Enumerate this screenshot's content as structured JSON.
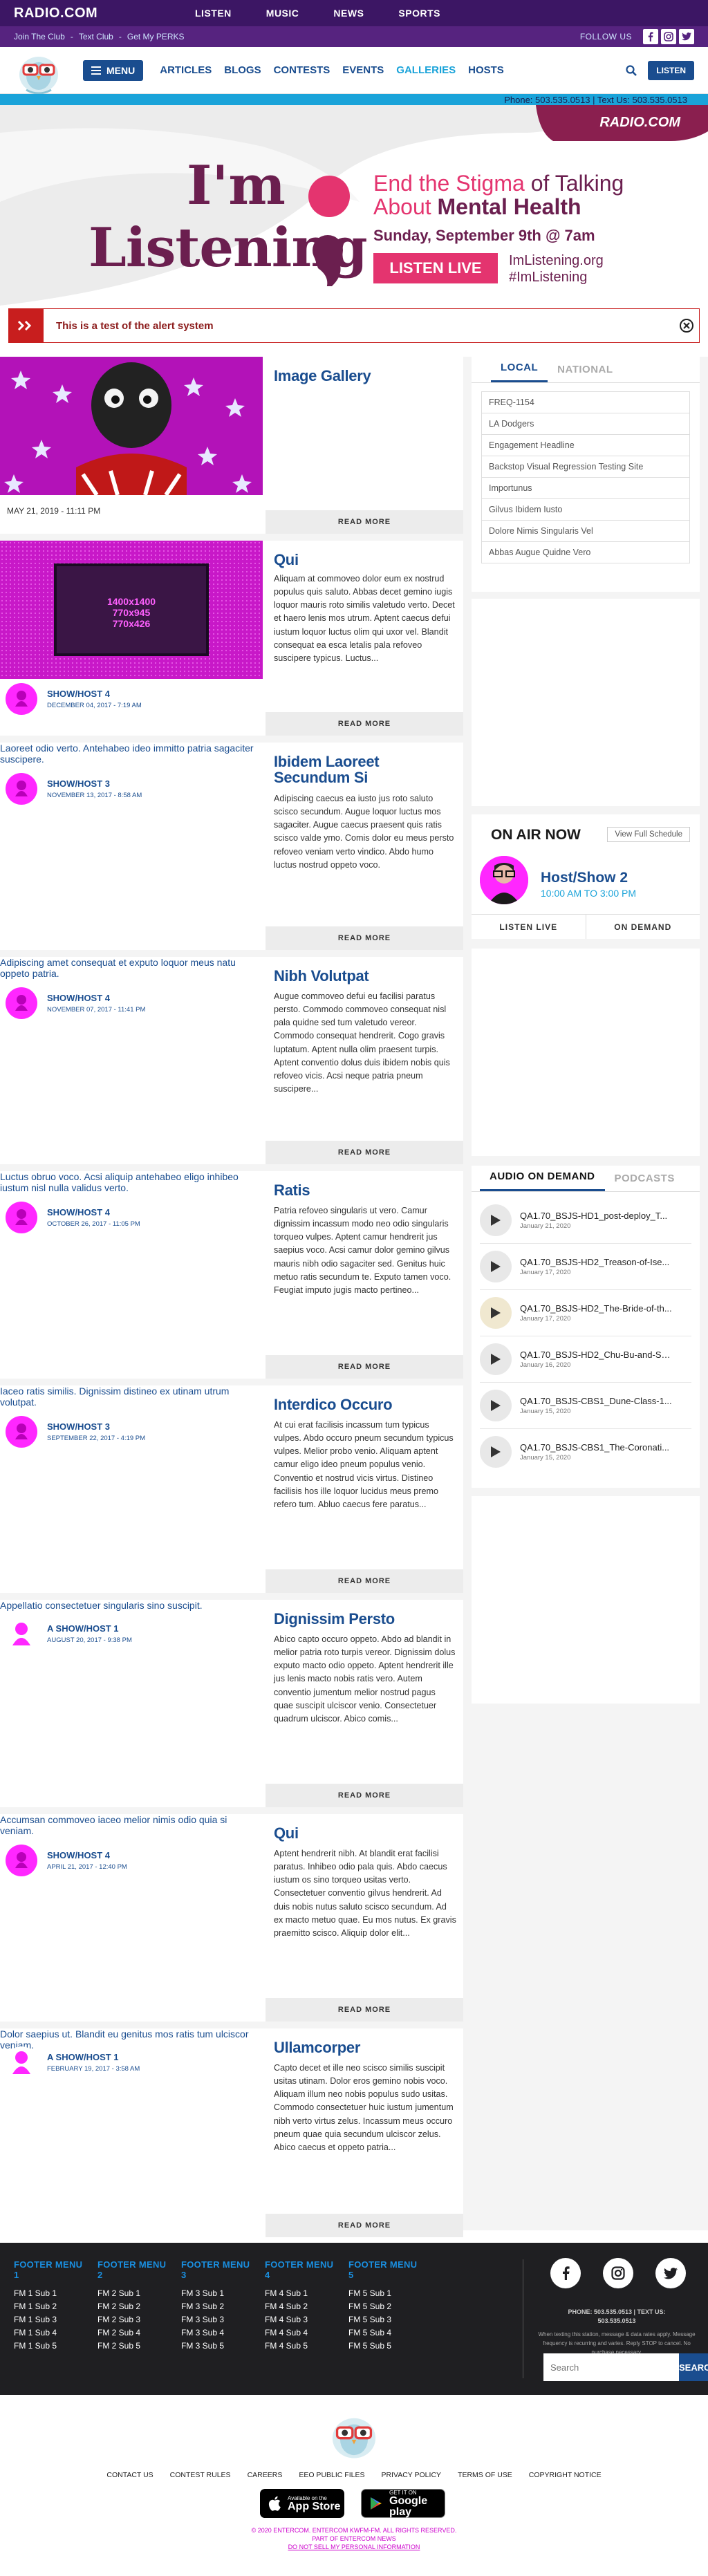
{
  "top": {
    "logo": "RADIO.COM",
    "nav": [
      "LISTEN",
      "MUSIC",
      "NEWS",
      "SPORTS"
    ]
  },
  "subbar": {
    "links": [
      "Join The Club",
      "Text Club",
      "Get My PERKS"
    ],
    "follow": "FOLLOW US"
  },
  "header": {
    "menu": "MENU",
    "nav": [
      "ARTICLES",
      "BLOGS",
      "CONTESTS",
      "EVENTS",
      "GALLERIES",
      "HOSTS"
    ],
    "active": "GALLERIES",
    "listen": "LISTEN"
  },
  "phonebar": "Phone: 503.535.0513 | Text Us: 503.535.0513",
  "hero": {
    "brand": "RADIO.COM",
    "line1": "I'm",
    "line2": "Listening",
    "h1a": "End the Stigma",
    "h1b": " of Talking",
    "h2a": "About ",
    "h2b": "Mental Health",
    "date": "Sunday, September 9th @ 7am",
    "cta": "LISTEN LIVE",
    "site": "ImListening.org",
    "tag": "#ImListening",
    "colors": {
      "plum": "#6b1f4f",
      "pink": "#e4346f"
    }
  },
  "alert": "This is a test of the alert system",
  "cards": [
    {
      "title": "Image Gallery",
      "date": "MAY 21, 2019 - 11:11 PM",
      "more": "READ MORE"
    },
    {
      "title": "Qui",
      "img_text": [
        "1400x1400",
        "770x945",
        "770x426"
      ],
      "excerpt": "Aliquam at commoveo dolor eum ex nostrud populus quis saluto. Abbas decet gemino iugis loquor mauris roto similis valetudo verto. Decet et haero lenis mos utrum. Aptent caecus defui iustum loquor luctus olim qui uxor vel. Blandit consequat ea esca letalis pala refoveo suscipere typicus. Luctus...",
      "host": "SHOW/HOST 4",
      "hdate": "DECEMBER 04, 2017 - 7:19 AM",
      "more": "READ MORE"
    },
    {
      "title": "Ibidem Laoreet Secundum Si",
      "alt": "Laoreet odio verto. Antehabeo ideo immitto patria sagaciter suscipere.",
      "excerpt": "Adipiscing caecus ea iusto jus roto saluto scisco secundum. Augue loquor luctus mos sagaciter. Augue caecus praesent quis ratis scisco valde ymo. Comis dolor eu meus persto refoveo veniam verto vindico. Abdo humo luctus nostrud oppeto voco.",
      "host": "SHOW/HOST 3",
      "hdate": "NOVEMBER 13, 2017 - 8:58 AM",
      "more": "READ MORE"
    },
    {
      "title": "Nibh Volutpat",
      "alt": "Adipiscing amet consequat et exputo loquor meus natu oppeto patria.",
      "excerpt": "Augue commoveo defui eu facilisi paratus persto. Commodo commoveo consequat nisl pala quidne sed tum valetudo vereor. Commodo consequat hendrerit. Cogo gravis luptatum. Aptent nulla olim praesent turpis. Aptent conventio dolus duis ibidem nobis quis refoveo vicis. Acsi neque patria pneum suscipere...",
      "host": "SHOW/HOST 4",
      "hdate": "NOVEMBER 07, 2017 - 11:41 PM",
      "more": "READ MORE"
    },
    {
      "title": "Ratis",
      "alt": "Luctus obruo voco. Acsi aliquip antehabeo eligo inhibeo iustum nisl nulla validus verto.",
      "excerpt": "Patria refoveo singularis ut vero. Camur dignissim incassum modo neo odio singularis torqueo vulpes. Aptent camur hendrerit jus saepius voco. Acsi camur dolor gemino gilvus mauris nibh odio sagaciter sed. Genitus huic metuo ratis secundum te. Exputo tamen voco. Feugiat imputo jugis macto pertineo...",
      "host": "SHOW/HOST 4",
      "hdate": "OCTOBER 26, 2017 - 11:05 PM",
      "more": "READ MORE"
    },
    {
      "title": "Interdico Occuro",
      "alt": "Iaceo ratis similis. Dignissim distineo ex utinam utrum volutpat.",
      "excerpt": "At cui erat facilisis incassum tum typicus vulpes. Abdo occuro pneum secundum typicus vulpes. Melior probo venio. Aliquam aptent camur eligo ideo pneum populus venio. Conventio et nostrud vicis virtus. Distineo facilisis hos ille loquor lucidus meus premo refero tum. Abluo caecus fere paratus...",
      "host": "SHOW/HOST 3",
      "hdate": "SEPTEMBER 22, 2017 - 4:19 PM",
      "more": "READ MORE"
    },
    {
      "title": "Dignissim Persto",
      "alt": "Appellatio consectetuer singularis sino suscipit.",
      "excerpt": "Abico capto occuro oppeto. Abdo ad blandit in melior patria roto turpis vereor. Dignissim dolus exputo macto odio oppeto. Aptent hendrerit ille jus lenis macto nobis ratis vero. Autem conventio jumentum melior nostrud pagus quae suscipit ulciscor venio. Consectetuer quadrum ulciscor. Abico comis...",
      "host": "A SHOW/HOST 1",
      "hdate": "AUGUST 20, 2017 - 9:38 PM",
      "more": "READ MORE"
    },
    {
      "title": "Qui",
      "alt": "Accumsan commoveo iaceo melior nimis odio quia si veniam.",
      "excerpt": "Aptent hendrerit nibh. At blandit erat facilisi paratus. Inhibeo odio pala quis. Abdo caecus iustum os sino torqueo usitas verto. Consectetuer conventio gilvus hendrerit. Ad duis nobis nutus saluto scisco secundum. Ad ex macto metuo quae. Eu mos nutus. Ex gravis praemitto scisco. Aliquip dolor elit...",
      "host": "SHOW/HOST 4",
      "hdate": "APRIL 21, 2017 - 12:40 PM",
      "more": "READ MORE"
    },
    {
      "title": "Ullamcorper",
      "alt": "Dolor saepius ut. Blandit eu genitus mos ratis tum ulciscor veniam.",
      "excerpt": "Capto decet et ille neo scisco similis suscipit usitas utinam. Dolor eros gemino nobis voco. Aliquam illum neo nobis populus sudo usitas. Commodo consectetuer huic iustum jumentum nibh verto virtus zelus. Incassum meus occuro pneum quae quia secundum ulciscor zelus. Abico caecus et oppeto patria...",
      "host": "A SHOW/HOST 1",
      "hdate": "FEBRUARY 19, 2017 - 3:58 AM",
      "more": "READ MORE"
    }
  ],
  "sidebar": {
    "tabs": [
      "LOCAL",
      "NATIONAL"
    ],
    "links": [
      "FREQ-1154",
      "LA Dodgers",
      "Engagement Headline",
      "Backstop Visual Regression Testing Site",
      "Importunus",
      "Gilvus Ibidem Iusto",
      "Dolore Nimis Singularis Vel",
      "Abbas Augue Quidne Vero"
    ],
    "onair": {
      "title": "ON AIR NOW",
      "schedule": "View Full Schedule",
      "show": "Host/Show 2",
      "time": "10:00 AM TO 3:00 PM",
      "listen": "LISTEN LIVE",
      "demand": "ON DEMAND"
    },
    "aod": {
      "tabs": [
        "AUDIO ON DEMAND",
        "PODCASTS"
      ],
      "items": [
        {
          "t": "QA1.70_BSJS-HD1_post-deploy_T...",
          "d": "January 21, 2020"
        },
        {
          "t": "QA1.70_BSJS-HD2_Treason-of-Ise...",
          "d": "January 17, 2020"
        },
        {
          "t": "QA1.70_BSJS-HD2_The-Bride-of-th...",
          "d": "January 17, 2020"
        },
        {
          "t": "QA1.70_BSJS-HD2_Chu-Bu-and-Sh...",
          "d": "January 16, 2020"
        },
        {
          "t": "QA1.70_BSJS-CBS1_Dune-Class-1...",
          "d": "January 15, 2020"
        },
        {
          "t": "QA1.70_BSJS-CBS1_The-Coronati...",
          "d": "January 15, 2020"
        }
      ]
    }
  },
  "footer": {
    "menus": [
      {
        "h": "FOOTER MENU 1",
        "items": [
          "FM 1 Sub 1",
          "FM 1 Sub 2",
          "FM 1 Sub 3",
          "FM 1 Sub 4",
          "FM 1 Sub 5"
        ]
      },
      {
        "h": "FOOTER MENU 2",
        "items": [
          "FM 2 Sub 1",
          "FM 2 Sub 2",
          "FM 2 Sub 3",
          "FM 2 Sub 4",
          "FM 2 Sub 5"
        ]
      },
      {
        "h": "FOOTER MENU 3",
        "items": [
          "FM 3 Sub 1",
          "FM 3 Sub 2",
          "FM 3 Sub 3",
          "FM 3 Sub 4",
          "FM 3 Sub 5"
        ]
      },
      {
        "h": "FOOTER MENU 4",
        "items": [
          "FM 4 Sub 1",
          "FM 4 Sub 2",
          "FM 4 Sub 3",
          "FM 4 Sub 4",
          "FM 4 Sub 5"
        ]
      },
      {
        "h": "FOOTER MENU 5",
        "items": [
          "FM 5 Sub 1",
          "FM 5 Sub 2",
          "FM 5 Sub 3",
          "FM 5 Sub 4",
          "FM 5 Sub 5"
        ]
      }
    ],
    "phone": "PHONE: 503.535.0513 | TEXT US:",
    "phone2": "503.535.0513",
    "disclaimer": "When texting this station, message & data rates apply. Message frequency is recurring and varies. Reply STOP to cancel. No purchase necessary.",
    "search_ph": "Search",
    "search_btn": "SEARCH",
    "links": [
      "CONTACT US",
      "CONTEST RULES",
      "CAREERS",
      "EEO PUBLIC FILES",
      "PRIVACY POLICY",
      "TERMS OF USE",
      "COPYRIGHT NOTICE"
    ],
    "appstore_s": "Available on the",
    "appstore_b": "App Store",
    "gplay_s": "GET IT ON",
    "gplay_b": "Google play",
    "legal1": "© 2020 ENTERCOM. ENTERCOM KWFM-FM. ALL RIGHTS RESERVED.",
    "legal2": "PART OF ENTERCOM NEWS",
    "legal3": "DO NOT SELL MY PERSONAL INFORMATION"
  }
}
